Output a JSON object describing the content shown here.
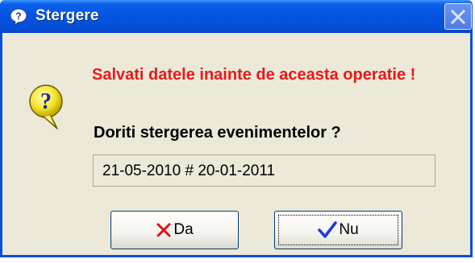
{
  "window": {
    "title": "Stergere",
    "title_icon": "help-question-icon",
    "close_icon": "close-icon"
  },
  "dialog": {
    "icon": "question-bubble-icon",
    "warning": "Salvati datele inainte de aceasta operatie !",
    "question": "Doriti stergerea evenimentelor ?",
    "range_value": "21-05-2010 # 20-01-2011"
  },
  "buttons": {
    "yes_label": "Da",
    "yes_icon": "red-x-icon",
    "no_label": "Nu",
    "no_icon": "blue-checkmark-icon"
  },
  "colors": {
    "titlebar": "#0554e3",
    "warning_text": "#e8191a",
    "dialog_bg": "#ece9d8"
  }
}
